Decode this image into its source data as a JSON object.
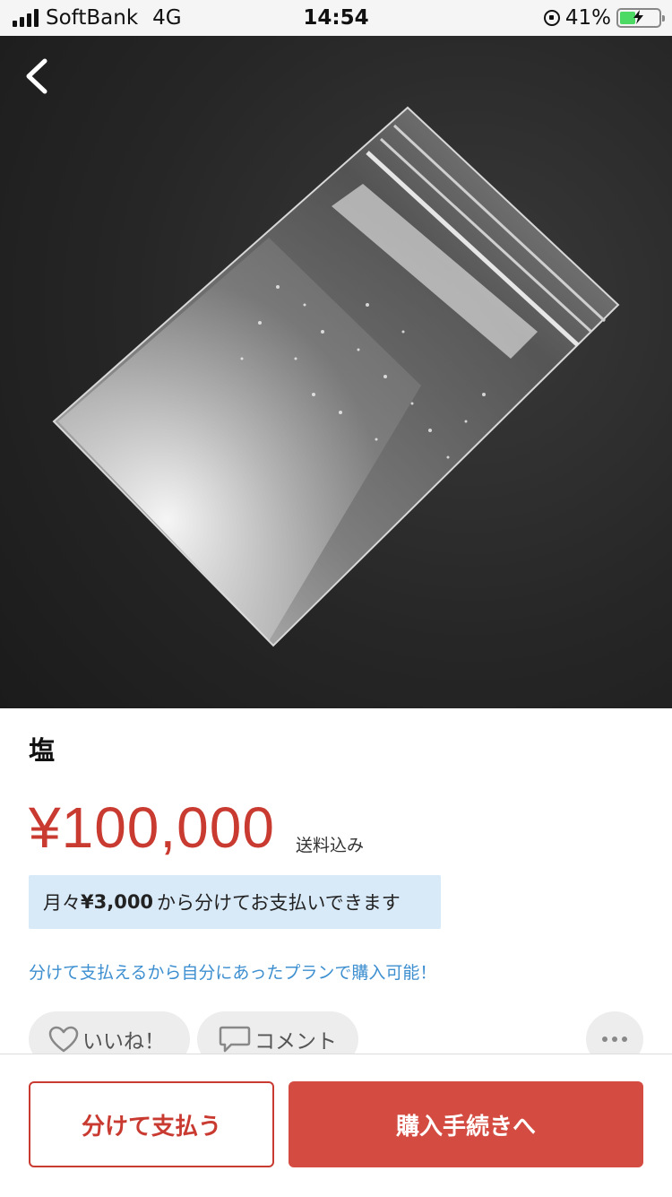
{
  "status_bar": {
    "carrier": "SoftBank",
    "network": "4G",
    "time": "14:54",
    "battery": "41%",
    "battery_fraction": 0.41,
    "battery_color": "#4cd964"
  },
  "product": {
    "title": "塩",
    "price": "¥100,000",
    "shipping_note": "送料込み"
  },
  "plan": {
    "prefix": "月々",
    "amount": "¥3,000",
    "suffix": "から分けてお支払いできます",
    "link_text": "分けて支払えるから自分にあったプランで購入可能！"
  },
  "actions": {
    "like_label": "いいね！",
    "comment_label": "コメント"
  },
  "bottom": {
    "split_pay_label": "分けて支払う",
    "buy_label": "購入手続きへ"
  },
  "colors": {
    "accent": "#c93a31",
    "buy_button": "#d44c41",
    "link": "#3d8fd0",
    "plan_background": "#d8e9f8"
  },
  "icons": {
    "back": "chevron-left-icon",
    "like": "heart-icon",
    "comment": "speech-bubble-icon",
    "more": "ellipsis-icon"
  }
}
